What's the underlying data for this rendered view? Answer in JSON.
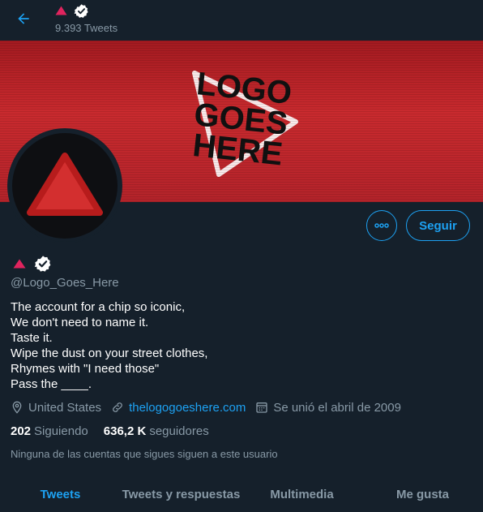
{
  "header": {
    "tweet_count": "9.393 Tweets",
    "back_icon": "arrow-left-icon",
    "verified_icon": "verified-badge-icon"
  },
  "banner": {
    "logo_text": [
      "LOGO",
      "GOES",
      "HERE"
    ]
  },
  "profile": {
    "handle": "@Logo_Goes_Here",
    "bio": [
      "The account for a chip so iconic,",
      "We don't need to name it.",
      "Taste it.",
      "Wipe the dust on your street clothes,",
      "Rhymes with \"I need those\"",
      "Pass the ____."
    ],
    "location": "United States",
    "website": "thelogogoeshere.com",
    "joined": "Se unió el abril de 2009",
    "following_count": "202",
    "following_label": "Siguiendo",
    "followers_count": "636,2 K",
    "followers_label": "seguidores",
    "mutuals_note": "Ninguna de las cuentas que sigues siguen a este usuario"
  },
  "actions": {
    "follow_label": "Seguir",
    "more_icon": "more-options-icon"
  },
  "tabs": [
    {
      "label": "Tweets",
      "active": true
    },
    {
      "label": "Tweets y respuestas",
      "active": false
    },
    {
      "label": "Multimedia",
      "active": false
    },
    {
      "label": "Me gusta",
      "active": false
    }
  ],
  "colors": {
    "background": "#15202b",
    "accent": "#1da1f2",
    "muted": "#8899a6",
    "brand_red": "#e0245e",
    "banner_red": "#c62828"
  }
}
